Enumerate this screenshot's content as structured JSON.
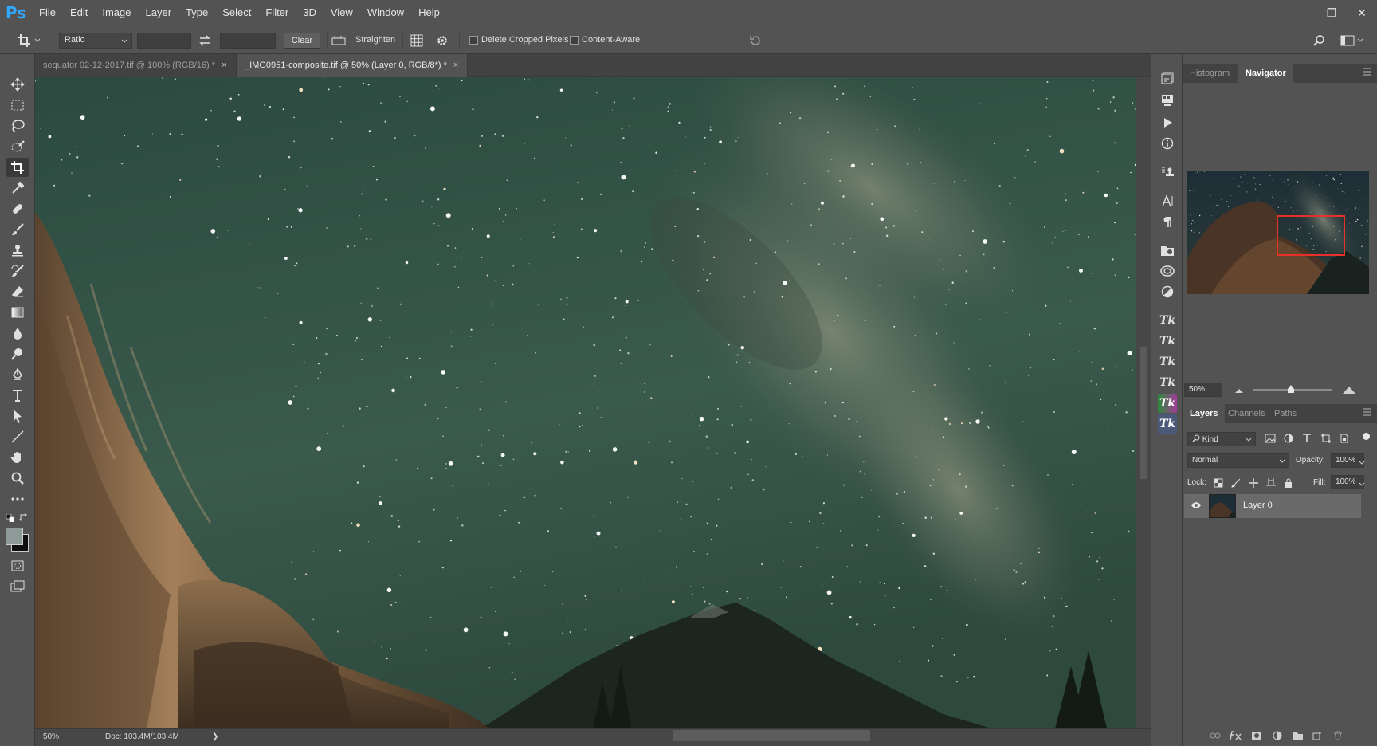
{
  "app": {
    "logo": "Ps",
    "menus": [
      "File",
      "Edit",
      "Image",
      "Layer",
      "Type",
      "Select",
      "Filter",
      "3D",
      "View",
      "Window",
      "Help"
    ],
    "window_controls": [
      "–",
      "❐",
      "✕"
    ]
  },
  "options": {
    "ratio_label": "Ratio",
    "clear_label": "Clear",
    "straighten_label": "Straighten",
    "delete_cropped_label": "Delete Cropped Pixels",
    "content_aware_label": "Content-Aware"
  },
  "tabs": [
    {
      "label": "sequator 02-12-2017.tif @ 100% (RGB/16) *",
      "close": "×"
    },
    {
      "label": "_IMG0951-composite.tif @ 50% (Layer 0, RGB/8*) *",
      "close": "×"
    }
  ],
  "status": {
    "zoom": "50%",
    "doc": "Doc: 103.4M/103.4M",
    "arrow": "❯"
  },
  "navigator": {
    "tabs": [
      "Histogram",
      "Navigator"
    ],
    "zoom": "50%",
    "zoom_fraction": 0.5
  },
  "layers_panel": {
    "tabs": [
      "Layers",
      "Channels",
      "Paths"
    ],
    "kind_label": "Kind",
    "blend_mode": "Normal",
    "opacity_label": "Opacity:",
    "opacity_value": "100%",
    "lock_label": "Lock:",
    "fill_label": "Fill:",
    "fill_value": "100%",
    "layers": [
      {
        "name": "Layer 0"
      }
    ]
  },
  "strip_tk_labels": [
    "Tk",
    "Tk",
    "Tk",
    "Tk",
    "Tk",
    "Tk"
  ],
  "colors": {
    "ps_blue": "#31a8ff",
    "nav_box": "#e8302a",
    "sky": "#2e4a40"
  }
}
